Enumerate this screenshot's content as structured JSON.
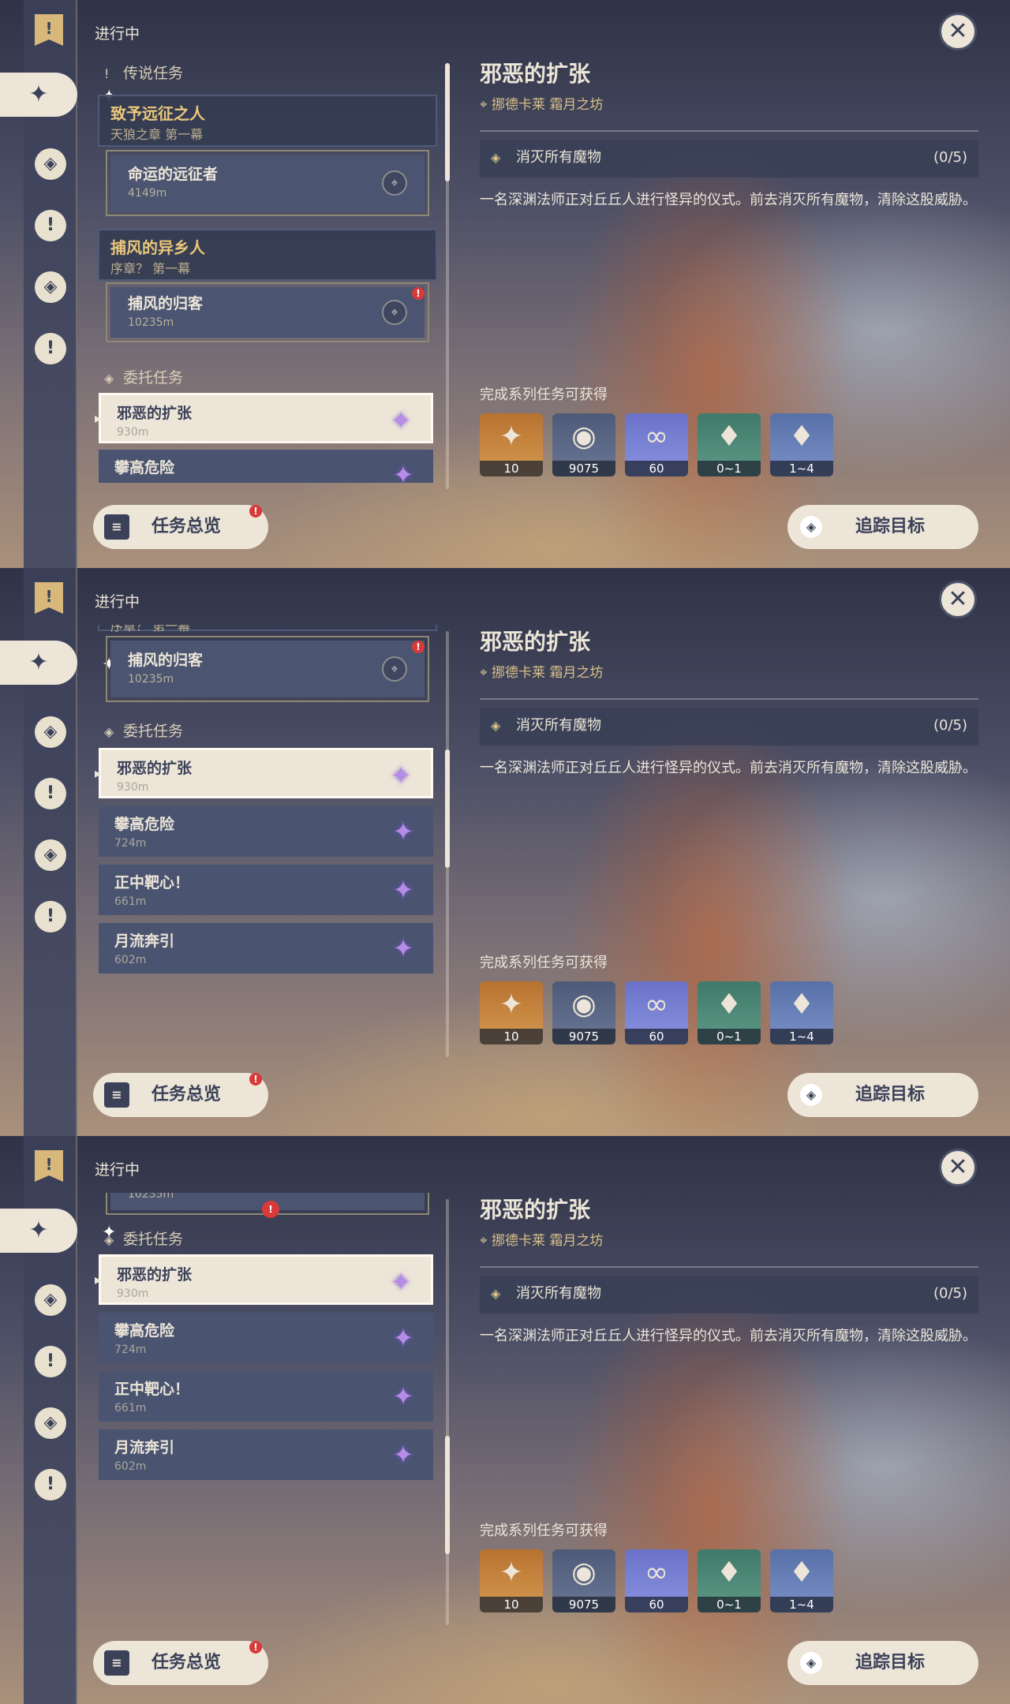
{
  "header": {
    "in_progress": "进行中"
  },
  "icons": {
    "close": "✕",
    "flag": "!",
    "active_nav": "✦",
    "nav_1": "◈",
    "nav_2": "!",
    "nav_3": "◈",
    "nav_4": "!",
    "spark": "✦"
  },
  "categories": {
    "legend": "传说任务",
    "commission": "委托任务"
  },
  "legend_quests": [
    {
      "title": "致予远征之人",
      "subtitle": "天狼之章 第一幕"
    },
    {
      "title": "捕风的异乡人",
      "subtitle": "序章？ 第一幕"
    }
  ],
  "sub_quests": [
    {
      "title": "命运的远征者",
      "distance": "4149m"
    },
    {
      "title": "捕风的归客",
      "distance": "10235m"
    }
  ],
  "partial_texts": {
    "subtitle_cut": "序章？ 第一幕",
    "distance_cut": "10235m"
  },
  "commissions": [
    {
      "title": "邪恶的扩张",
      "distance": "930m"
    },
    {
      "title": "攀高危险",
      "distance": "724m"
    },
    {
      "title": "正中靶心！",
      "distance": "661m"
    },
    {
      "title": "月流奔引",
      "distance": "602m"
    }
  ],
  "detail": {
    "title": "邪恶的扩张",
    "location": "挪德卡莱 霜月之坊",
    "objective": "消灭所有魔物",
    "progress": "(0/5)",
    "description": "一名深渊法师正对丘丘人进行怪异的仪式。前去消灭所有魔物，清除这股威胁。",
    "rewards_header": "完成系列任务可获得",
    "rewards": [
      {
        "icon": "✦",
        "amount": "10"
      },
      {
        "icon": "◉",
        "amount": "9075"
      },
      {
        "icon": "∞",
        "amount": "60"
      },
      {
        "icon": "♦",
        "amount": "0~1"
      },
      {
        "icon": "♦",
        "amount": "1~4"
      }
    ]
  },
  "footer": {
    "overview": "任务总览",
    "track": "追踪目标"
  },
  "colors": {
    "accent": "#ece5d8",
    "gold": "#d8c08a",
    "star": "#b58ce6",
    "badge": "#d83a3a"
  }
}
